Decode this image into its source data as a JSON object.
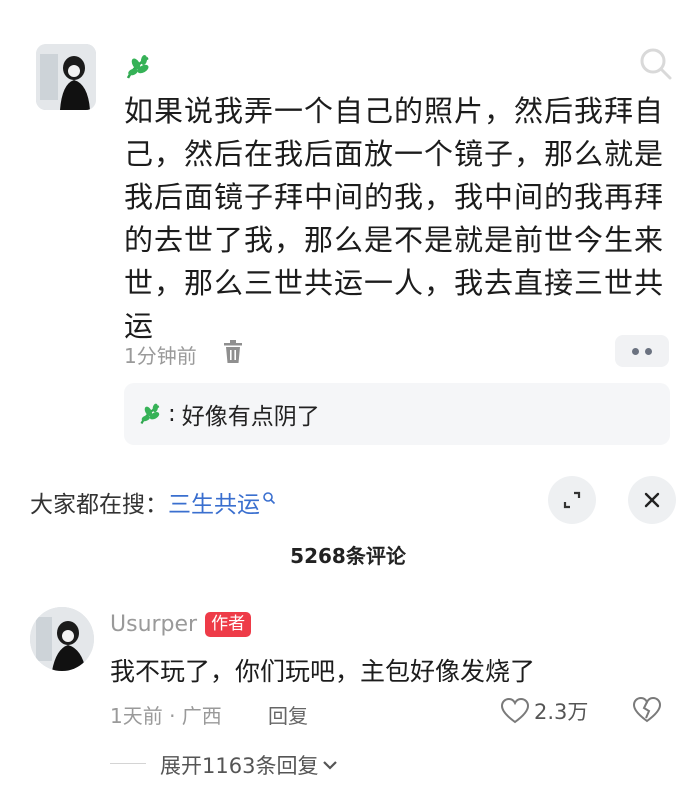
{
  "post": {
    "text": "如果说我弄一个自己的照片，然后我拜自己，然后在我后面放一个镜子，那么就是我后面镜子拜中间的我，我中间的我再拜的去世了我，那么是不是就是前世今生来世，那么三世共运一人，我去直接三世共运",
    "time": "1分钟前",
    "leaf_icon": "leaf-icon",
    "more_icon": "more-dots-icon",
    "delete_icon": "trash-icon",
    "search_icon": "search-icon"
  },
  "quote": {
    "text": "好像有点阴了"
  },
  "trending": {
    "label": "大家都在搜：",
    "query": "三生共运",
    "expand_icon": "expand-icon",
    "close_icon": "close-icon"
  },
  "comments_count": "5268条评论",
  "comment": {
    "username": "Usurper",
    "author_tag": "作者",
    "text": "我不玩了，你们玩吧，主包好像发烧了",
    "time_location": "1天前 · 广西",
    "reply_label": "回复",
    "like_count": "2.3万",
    "expand_replies": "展开1163条回复"
  },
  "colors": {
    "link": "#3a6fcf",
    "tag_bg": "#ee3b48",
    "leaf": "#2fa44f",
    "meta": "#9a9a9a"
  }
}
